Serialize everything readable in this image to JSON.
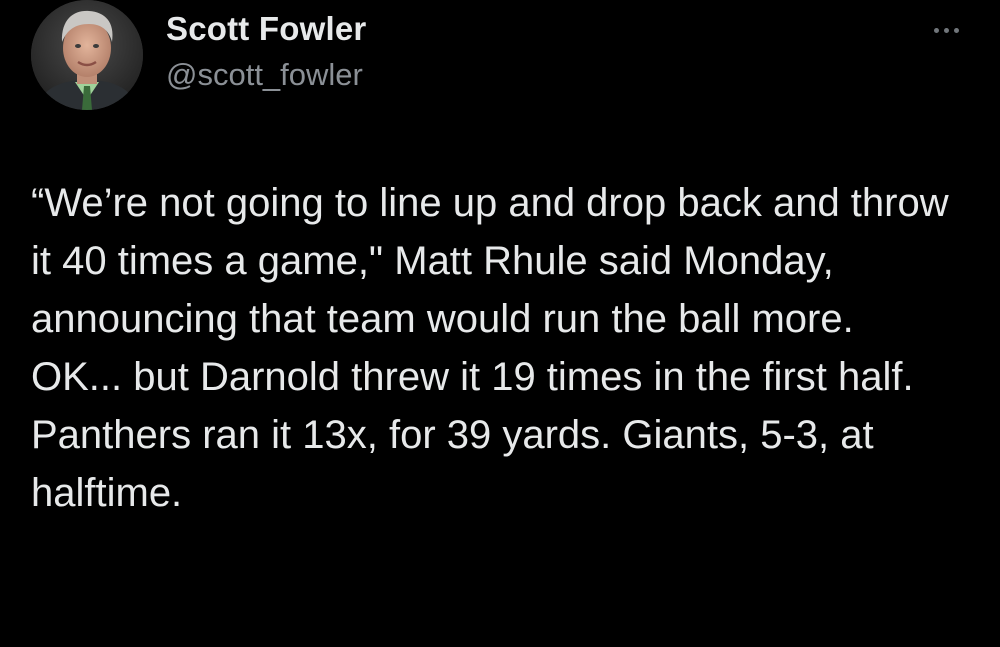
{
  "author": {
    "display_name": "Scott Fowler",
    "handle": "@scott_fowler",
    "avatar_icon": "profile-photo"
  },
  "actions": {
    "more_icon": "more-horizontal-icon"
  },
  "tweet": {
    "paragraph_1": "“We’re not going to line up and drop back and throw it 40 times a game,\" Matt Rhule said Monday, announcing that team would run the ball more.",
    "paragraph_2": "OK... but Darnold threw it 19 times in the first half. Panthers ran it 13x, for 39 yards. Giants, 5-3, at halftime."
  },
  "colors": {
    "background": "#000000",
    "primary_text": "#e7e9ea",
    "secondary_text": "#8b9096"
  }
}
